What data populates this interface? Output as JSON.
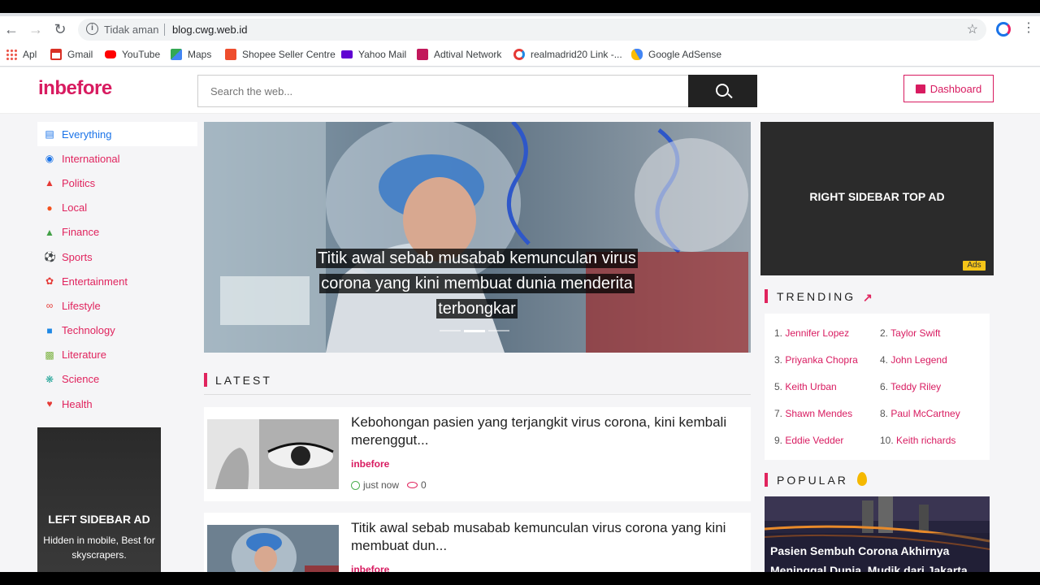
{
  "browser": {
    "security_label": "Tidak aman",
    "url": "blog.cwg.web.id",
    "bookmarks": [
      {
        "label": "Apl",
        "icon": "apps-grid-icon",
        "color": "#ea4335"
      },
      {
        "label": "Gmail",
        "icon": "gmail-icon",
        "color": "#d93025"
      },
      {
        "label": "YouTube",
        "icon": "youtube-icon",
        "color": "#ff0000"
      },
      {
        "label": "Maps",
        "icon": "maps-icon",
        "color": "#34a853"
      },
      {
        "label": "Shopee Seller Centre",
        "icon": "shopee-icon",
        "color": "#ee4d2d"
      },
      {
        "label": "Yahoo Mail",
        "icon": "yahoo-mail-icon",
        "color": "#6001d2"
      },
      {
        "label": "Adtival Network",
        "icon": "adtival-icon",
        "color": "#c2185b"
      },
      {
        "label": "realmadrid20 Link -...",
        "icon": "realmadrid-icon",
        "color": "#e53935"
      },
      {
        "label": "Google AdSense",
        "icon": "adsense-icon",
        "color": "#fbbc04"
      }
    ]
  },
  "site": {
    "logo": "inbefore",
    "search_placeholder": "Search the web...",
    "dashboard_label": "Dashboard",
    "accent": "#d81b60"
  },
  "categories": [
    {
      "label": "Everything",
      "icon": "newspaper-icon",
      "active": true
    },
    {
      "label": "International",
      "icon": "globe-icon"
    },
    {
      "label": "Politics",
      "icon": "capitol-icon"
    },
    {
      "label": "Local",
      "icon": "location-person-icon"
    },
    {
      "label": "Finance",
      "icon": "chart-icon"
    },
    {
      "label": "Sports",
      "icon": "ball-icon"
    },
    {
      "label": "Entertainment",
      "icon": "film-icon"
    },
    {
      "label": "Lifestyle",
      "icon": "glasses-icon"
    },
    {
      "label": "Technology",
      "icon": "camera-icon"
    },
    {
      "label": "Literature",
      "icon": "book-icon"
    },
    {
      "label": "Science",
      "icon": "atom-icon"
    },
    {
      "label": "Health",
      "icon": "heart-icon"
    }
  ],
  "left_ad": {
    "title": "LEFT SIDEBAR AD",
    "subtitle": "Hidden in mobile, Best for skyscrapers."
  },
  "hero": {
    "caption": "Titik awal sebab musabab kemunculan virus corona yang kini membuat dunia menderita terbongkar"
  },
  "latest": {
    "heading": "LATEST",
    "articles": [
      {
        "title": "Kebohongan pasien yang terjangkit virus corona, kini kembali merenggut...",
        "source": "inbefore",
        "time": "just now",
        "views": "0"
      },
      {
        "title": "Titik awal sebab musabab kemunculan virus corona yang kini membuat dun...",
        "source": "inbefore"
      }
    ]
  },
  "right_ad": {
    "title": "RIGHT SIDEBAR TOP AD",
    "tag": "Ads"
  },
  "trending": {
    "heading": "TRENDING",
    "items": [
      {
        "n": "1.",
        "name": "Jennifer Lopez"
      },
      {
        "n": "2.",
        "name": "Taylor Swift"
      },
      {
        "n": "3.",
        "name": "Priyanka Chopra"
      },
      {
        "n": "4.",
        "name": "John Legend"
      },
      {
        "n": "5.",
        "name": "Keith Urban"
      },
      {
        "n": "6.",
        "name": "Teddy Riley"
      },
      {
        "n": "7.",
        "name": "Shawn Mendes"
      },
      {
        "n": "8.",
        "name": "Paul McCartney"
      },
      {
        "n": "9.",
        "name": "Eddie Vedder"
      },
      {
        "n": "10.",
        "name": "Keith richards"
      }
    ]
  },
  "popular": {
    "heading": "POPULAR",
    "title": "Pasien Sembuh Corona Akhirnya Meninggal Dunia, Mudik dari Jakarta"
  }
}
